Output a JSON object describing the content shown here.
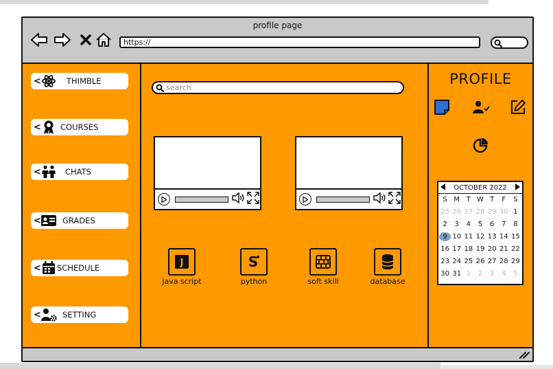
{
  "window": {
    "title": "profile page",
    "url": "https://"
  },
  "sidebar": {
    "items": [
      {
        "label": "THIMBLE",
        "icon": "atom-icon"
      },
      {
        "label": "COURSES",
        "icon": "award-icon"
      },
      {
        "label": "CHATS",
        "icon": "people-icon"
      },
      {
        "label": "GRADES",
        "icon": "id-card-icon"
      },
      {
        "label": "SCHEDULE",
        "icon": "calendar-icon"
      },
      {
        "label": "SETTING",
        "icon": "user-gear-icon"
      }
    ]
  },
  "main": {
    "search_placeholder": "search",
    "courses": [
      {
        "label": "java script",
        "glyph": "J"
      },
      {
        "label": "python",
        "glyph": "S"
      },
      {
        "label": "soft skill",
        "glyph": ""
      },
      {
        "label": "database",
        "glyph": ""
      }
    ]
  },
  "profile": {
    "title": "PROFILE",
    "calendar": {
      "month": "OCTOBER 2022",
      "weekdays": [
        "S",
        "M",
        "T",
        "W",
        "T",
        "F",
        "S"
      ],
      "rows": [
        [
          "25",
          "26",
          "27",
          "28",
          "29",
          "30",
          "1"
        ],
        [
          "2",
          "3",
          "4",
          "5",
          "6",
          "7",
          "8"
        ],
        [
          "9",
          "10",
          "11",
          "12",
          "13",
          "14",
          "15"
        ],
        [
          "16",
          "17",
          "18",
          "19",
          "20",
          "21",
          "22"
        ],
        [
          "23",
          "24",
          "25",
          "26",
          "27",
          "28",
          "29"
        ],
        [
          "30",
          "31",
          "1",
          "2",
          "3",
          "4",
          "5"
        ]
      ],
      "selected": "9"
    }
  },
  "colors": {
    "accent": "#ff9900",
    "chrome": "#c9c9c9",
    "highlight": "#7d9fc9",
    "note_blue": "#2f6fd6"
  }
}
